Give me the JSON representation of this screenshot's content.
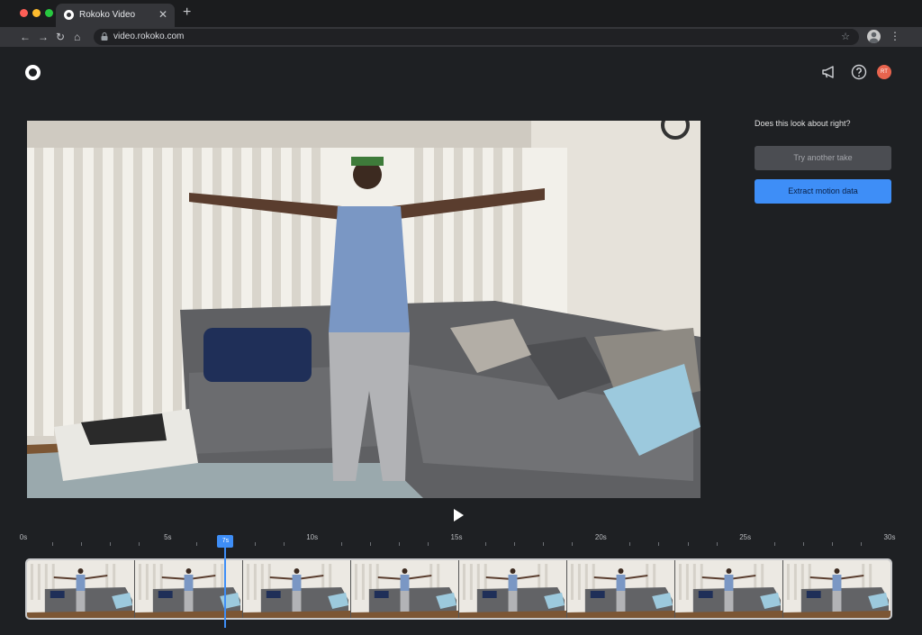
{
  "browser": {
    "tab_title": "Rokoko Video",
    "tab_close": "✕",
    "new_tab": "+",
    "url": "video.rokoko.com",
    "nav_back": "←",
    "nav_forward": "→",
    "nav_reload": "↻",
    "nav_home": "⌂",
    "star": "☆",
    "kebab": "⋮"
  },
  "header": {
    "avatar_initials": "RT",
    "icons": [
      "logo-icon",
      "megaphone-icon",
      "help-icon",
      "avatar"
    ]
  },
  "side_panel": {
    "question": "Does this look about right?",
    "try_label": "Try another take",
    "extract_label": "Extract motion data"
  },
  "timeline": {
    "ticks": [
      {
        "label": "0s",
        "t": 0
      },
      {
        "label": "5s",
        "t": 5
      },
      {
        "label": "10s",
        "t": 10
      },
      {
        "label": "15s",
        "t": 15
      },
      {
        "label": "20s",
        "t": 20
      },
      {
        "label": "25s",
        "t": 25
      },
      {
        "label": "30s",
        "t": 30
      }
    ],
    "duration": 30,
    "current": "7s",
    "current_value": 7,
    "frame_count": 8
  },
  "colors": {
    "accent": "#3e8ef7",
    "background": "#1e2023",
    "avatar": "#e8644e"
  }
}
